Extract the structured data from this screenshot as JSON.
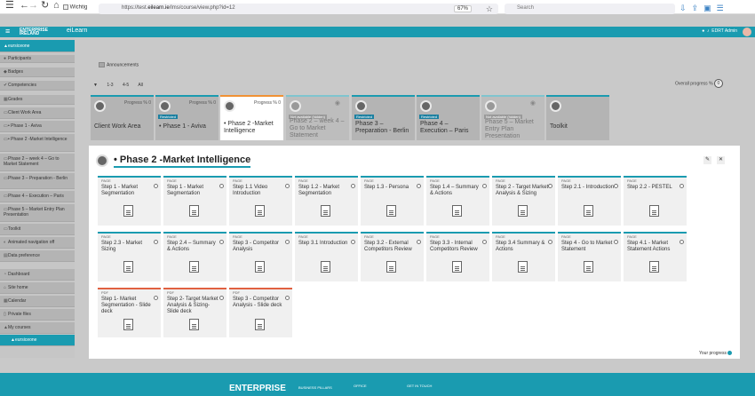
{
  "browser": {
    "tab_title": "Wichtig",
    "url_prefix": "https://test.",
    "url_host": "eilearn.ie",
    "url_path": "/lms/course/view.php?id=12",
    "zoom": "67%",
    "search_placeholder": "Search"
  },
  "appbar": {
    "brand_line1": "ENTERPRISE",
    "brand_line2": "IRELAND",
    "app_name": "eiLearn",
    "user_name": "EDRT Admin"
  },
  "sidebar": {
    "course": "eursiceone",
    "items": [
      {
        "label": "Participants",
        "icon": "users-icon"
      },
      {
        "label": "Badges",
        "icon": "badge-icon"
      },
      {
        "label": "Competencies",
        "icon": "competency-icon"
      },
      {
        "label": "Grades",
        "icon": "grades-icon"
      },
      {
        "label": "Client Work Area",
        "icon": "folder-icon"
      },
      {
        "label": "• Phase 1 - Aviva",
        "icon": "folder-icon"
      },
      {
        "label": "• Phase 2 -Market Intelligence",
        "icon": "folder-icon"
      },
      {
        "label": "Phase 2 – week 4 – Go to Market Statement",
        "icon": "folder-icon"
      },
      {
        "label": "Phase 3 – Preparation - Berlin",
        "icon": "folder-icon"
      },
      {
        "label": "Phase 4 – Execution – Paris",
        "icon": "folder-icon"
      },
      {
        "label": "Phase 5 – Market Entry Plan Presentation",
        "icon": "folder-icon"
      },
      {
        "label": "Toolkit",
        "icon": "folder-icon"
      },
      {
        "label": "Animated navigation off",
        "icon": "toggle-icon"
      },
      {
        "label": "Data preference",
        "icon": "settings-icon"
      },
      {
        "label": "Dashboard",
        "icon": "dashboard-icon"
      },
      {
        "label": "Site home",
        "icon": "home-icon"
      },
      {
        "label": "Calendar",
        "icon": "calendar-icon"
      },
      {
        "label": "Private files",
        "icon": "file-icon"
      },
      {
        "label": "My courses",
        "icon": "courses-icon"
      },
      {
        "label": "eursiceone",
        "icon": "course-icon"
      }
    ]
  },
  "main": {
    "announcements": "Announcements",
    "filters": [
      "1-3",
      "4-5",
      "All"
    ],
    "overall_progress_label": "Overall progress %",
    "overall_progress_value": "0",
    "sections": [
      {
        "title": "Client Work Area",
        "progress": "Progress % 0",
        "badge": ""
      },
      {
        "title": "• Phase 1 - Aviva",
        "progress": "Progress % 0",
        "badge": "Restricted"
      },
      {
        "title": "• Phase 2 -Market Intelligence",
        "progress": "Progress % 0",
        "badge": ""
      },
      {
        "title": "Phase 2 – week 4 – Go to Market Statement",
        "progress": "",
        "badge": "Not available (hidden)"
      },
      {
        "title": "Phase 3 – Preparation - Berlin",
        "progress": "",
        "badge": "Restricted"
      },
      {
        "title": "Phase 4 – Execution – Paris",
        "progress": "",
        "badge": "Restricted"
      },
      {
        "title": "Phase 5 – Market Entry Plan Presentation",
        "progress": "",
        "badge": "Not available (hidden)"
      },
      {
        "title": "Toolkit",
        "progress": "",
        "badge": ""
      }
    ],
    "panel_title": "• Phase 2 -Market Intelligence",
    "activities": [
      {
        "type": "PAGE",
        "name": "Step 1 - Market Segmentation"
      },
      {
        "type": "PAGE",
        "name": "Step 1 - Market Segmentation"
      },
      {
        "type": "PAGE",
        "name": "Step 1.1 Video Introduction"
      },
      {
        "type": "PAGE",
        "name": "Step 1.2 - Market Segmentation"
      },
      {
        "type": "PAGE",
        "name": "Step 1.3 - Persona"
      },
      {
        "type": "PAGE",
        "name": "Step 1.4 – Summary & Actions"
      },
      {
        "type": "PAGE",
        "name": "Step 2 - Target Market Analysis & Sizing"
      },
      {
        "type": "PAGE",
        "name": "Step 2.1 - Introduction"
      },
      {
        "type": "PAGE",
        "name": "Step 2.2 - PESTEL"
      },
      {
        "type": "PAGE",
        "name": "Step 2.3 - Market Sizing"
      },
      {
        "type": "PAGE",
        "name": "Step 2.4 – Summary & Actions"
      },
      {
        "type": "PAGE",
        "name": "Step 3 - Competitor Analysis"
      },
      {
        "type": "PAGE",
        "name": "Step 3.1 Introduction"
      },
      {
        "type": "PAGE",
        "name": "Step 3.2 - External Competitors Review"
      },
      {
        "type": "PAGE",
        "name": "Step 3.3 - Internal Competitors Review"
      },
      {
        "type": "PAGE",
        "name": "Step 3.4 Summary & Actions"
      },
      {
        "type": "PAGE",
        "name": "Step 4 - Go to Market Statement"
      },
      {
        "type": "PAGE",
        "name": "Step 4.1 - Market Statement Actions"
      },
      {
        "type": "PDF",
        "name": "Step 1- Market Segmentation - Slide deck"
      },
      {
        "type": "PDF",
        "name": "Step 2- Target Market Analysis & Sizing- Slide deck"
      },
      {
        "type": "PDF",
        "name": "Step 3 - Competitor Analysis - Slide deck"
      }
    ],
    "your_progress": "Your progress"
  },
  "footer": {
    "logo": "ENTERPRISE",
    "col1": "BUSINESS PILLARS",
    "col2": "OFFICE",
    "col3": "GET IN TOUCH"
  }
}
